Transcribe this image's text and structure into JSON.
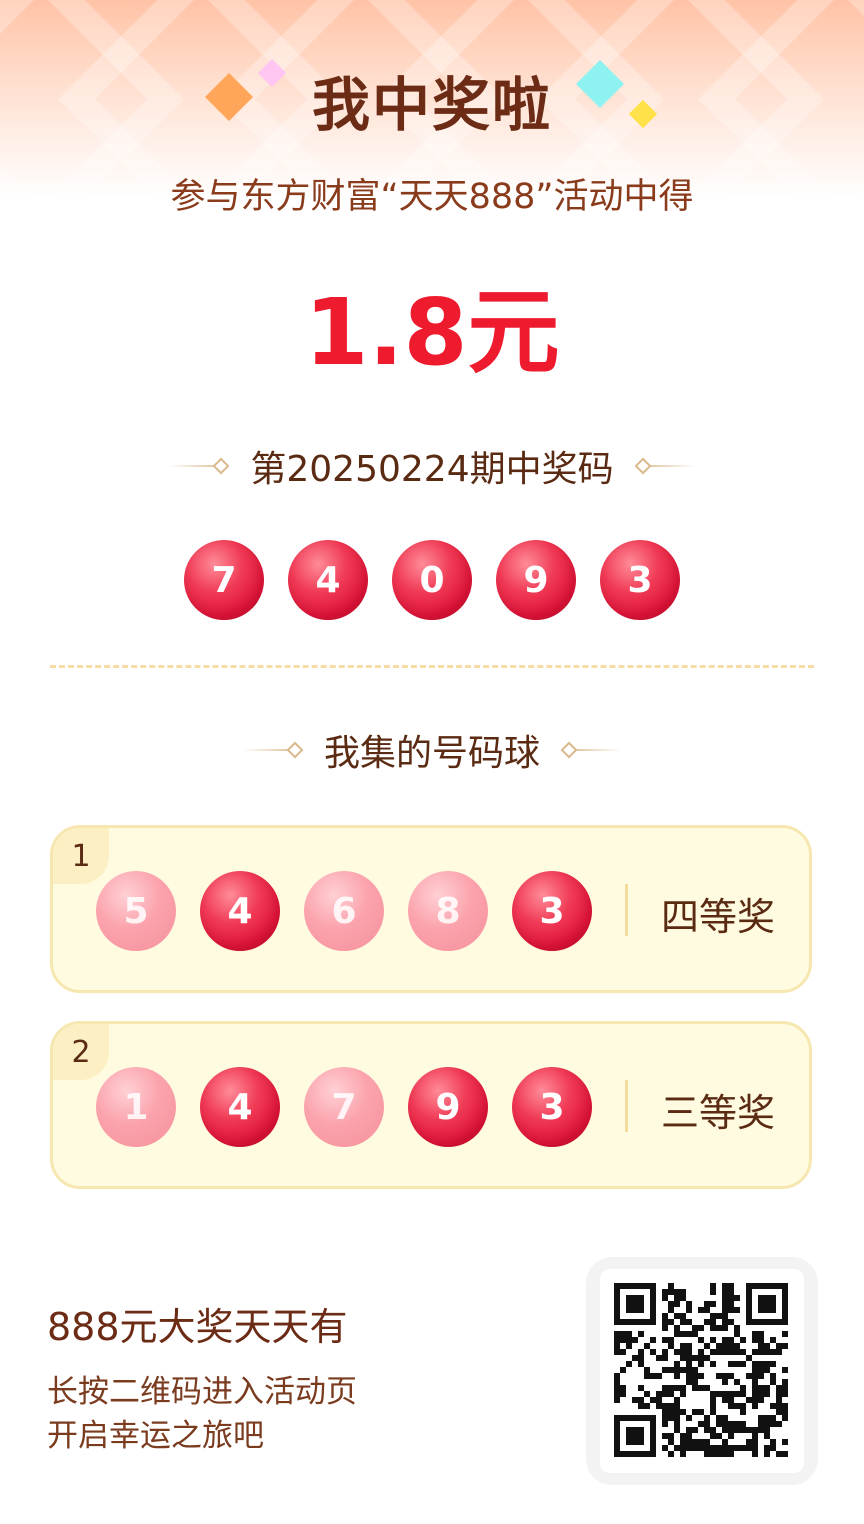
{
  "header": {
    "title": "我中奖啦"
  },
  "result": {
    "subtitle": "参与东方财富“天天888”活动中得",
    "amount": "1.8元"
  },
  "draw": {
    "title": "第20250224期中奖码",
    "numbers": [
      "7",
      "4",
      "0",
      "9",
      "3"
    ]
  },
  "collection": {
    "title": "我集的号码球",
    "cards": [
      {
        "index": "1",
        "balls": [
          "5",
          "4",
          "6",
          "8",
          "3"
        ],
        "matched": [
          false,
          true,
          false,
          false,
          true
        ],
        "prize": "四等奖"
      },
      {
        "index": "2",
        "balls": [
          "1",
          "4",
          "7",
          "9",
          "3"
        ],
        "matched": [
          false,
          true,
          false,
          true,
          true
        ],
        "prize": "三等奖"
      }
    ]
  },
  "footer": {
    "title": "888元大奖天天有",
    "line1": "长按二维码进入活动页",
    "line2": "开启幸运之旅吧"
  },
  "colors": {
    "accent": "#ee1b2e",
    "text_brown": "#5a2a12",
    "card_bg": "#fffbe0",
    "card_border": "#f6e7b0"
  },
  "icons": [
    "qr-code-icon",
    "orange-diamond-icon",
    "pink-diamond-icon",
    "cyan-diamond-icon",
    "yellow-diamond-icon"
  ]
}
